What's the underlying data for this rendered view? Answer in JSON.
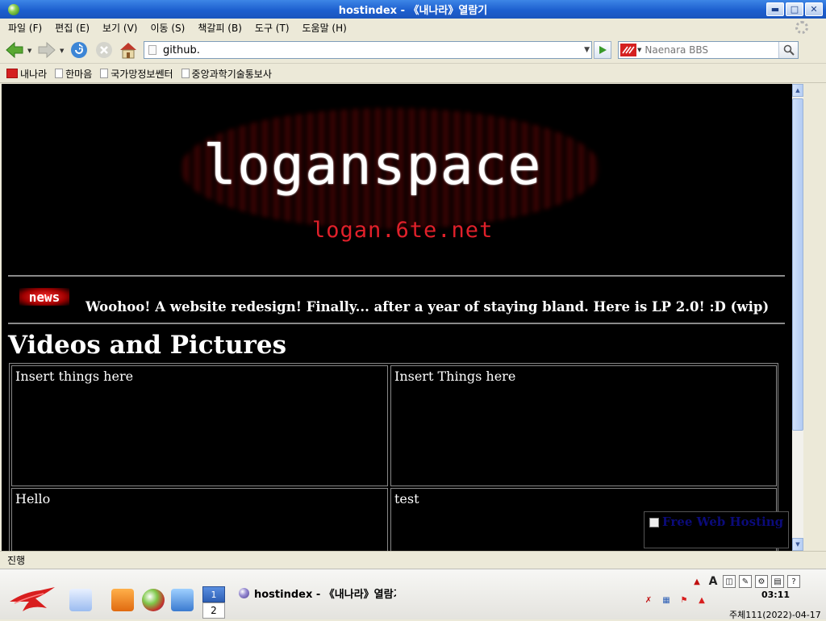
{
  "window": {
    "title": "hostindex - 《내나라》열람기"
  },
  "menu": [
    "파일 (F)",
    "편집 (E)",
    "보기 (V)",
    "이동 (S)",
    "책갈피 (B)",
    "도구 (T)",
    "도움말 (H)"
  ],
  "nav": {
    "url": "github.",
    "search_placeholder": "Naenara BBS",
    "engine_label": "내나라"
  },
  "bookmarks": [
    "내나라",
    "한마음",
    "국가망정보쎈터",
    "중앙과학기술통보사"
  ],
  "page": {
    "site_title": "loganspace",
    "site_url": "logan.6te.net",
    "news_badge": "news",
    "news_text": "Woohoo! A website redesign! Finally... after a year of staying bland. Here is LP 2.0! :D (wip)",
    "section_title": "Videos and Pictures",
    "cells": [
      "Insert things here",
      "Insert Things here",
      "Hello",
      "test"
    ],
    "hosting_link": "Free Web Hosting"
  },
  "status": {
    "text": "진행"
  },
  "taskbar": {
    "workspaces": [
      "1",
      "2"
    ],
    "task_title": "hostindex - 《내나라》열람기",
    "clock": "03:11",
    "date": "주체111(2022)-04-17"
  }
}
